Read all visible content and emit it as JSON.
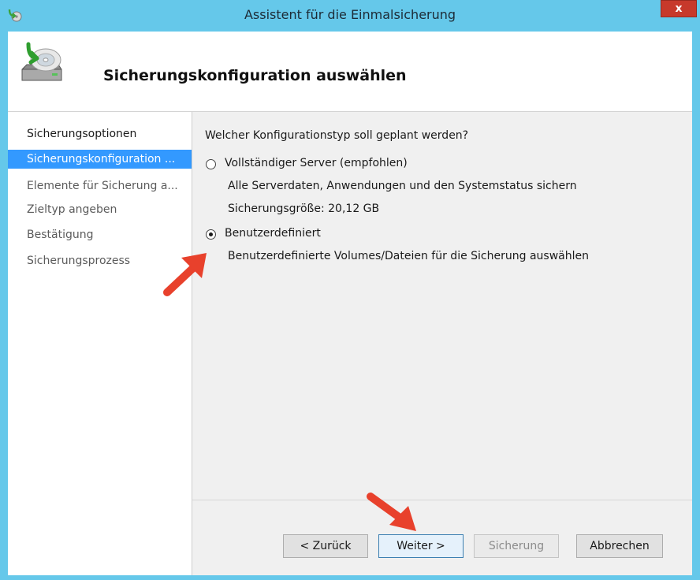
{
  "window": {
    "title": "Assistent für die Einmalsicherung",
    "close_label": "x"
  },
  "header": {
    "title": "Sicherungskonfiguration auswählen",
    "icon": "backup-drive-icon"
  },
  "sidebar": {
    "items": [
      {
        "label": "Sicherungsoptionen",
        "state": "normal"
      },
      {
        "label": "Sicherungskonfiguration ...",
        "state": "active"
      },
      {
        "label": "Elemente für Sicherung a...",
        "state": "inactive"
      },
      {
        "label": "Zieltyp angeben",
        "state": "inactive"
      },
      {
        "label": "Bestätigung",
        "state": "inactive"
      },
      {
        "label": "Sicherungsprozess",
        "state": "inactive"
      }
    ]
  },
  "main": {
    "question": "Welcher Konfigurationstyp soll geplant werden?",
    "options": [
      {
        "label": "Vollständiger Server (empfohlen)",
        "description": "Alle Serverdaten, Anwendungen und den Systemstatus sichern",
        "size_info": "Sicherungsgröße: 20,12 GB",
        "selected": false
      },
      {
        "label": "Benutzerdefiniert",
        "description": "Benutzerdefinierte Volumes/Dateien für die Sicherung auswählen",
        "selected": true
      }
    ]
  },
  "footer": {
    "back_label": "< Zurück",
    "next_label": "Weiter >",
    "backup_label": "Sicherung",
    "cancel_label": "Abbrechen"
  },
  "colors": {
    "titlebar": "#65c8ea",
    "selection": "#3399ff",
    "annotation_arrow": "#e8412c",
    "close_button": "#c7392b"
  }
}
